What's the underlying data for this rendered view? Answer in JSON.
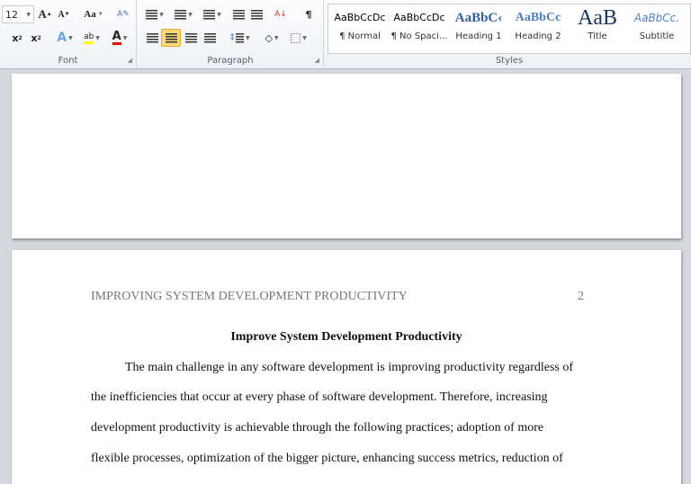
{
  "ribbon": {
    "font": {
      "label": "Font",
      "size": "12"
    },
    "paragraph": {
      "label": "Paragraph"
    },
    "styles": {
      "label": "Styles",
      "items": [
        {
          "preview": "AaBbCcDc",
          "name": "¶ Normal",
          "color": "#111"
        },
        {
          "preview": "AaBbCcDc",
          "name": "¶ No Spaci...",
          "color": "#111"
        },
        {
          "preview": "AaBbC‹",
          "name": "Heading 1",
          "color": "#365f91"
        },
        {
          "preview": "AaBbCc",
          "name": "Heading 2",
          "color": "#4f81bd"
        },
        {
          "preview": "AaB",
          "name": "Title",
          "color": "#17365d"
        },
        {
          "preview": "AaBbCc.",
          "name": "Subtitle",
          "color": "#4f81bd"
        }
      ]
    }
  },
  "document": {
    "header": "IMPROVING SYSTEM DEVELOPMENT PRODUCTIVITY",
    "page_number": "2",
    "title": "Improve System Development Productivity",
    "lines": [
      "The main challenge in any software development is improving productivity regardless of",
      "the inefficiencies that occur at every phase of software development. Therefore, increasing",
      "development productivity is achievable through the following practices; adoption of more",
      "flexible processes, optimization of the bigger picture, enhancing success metrics, reduction of"
    ]
  }
}
